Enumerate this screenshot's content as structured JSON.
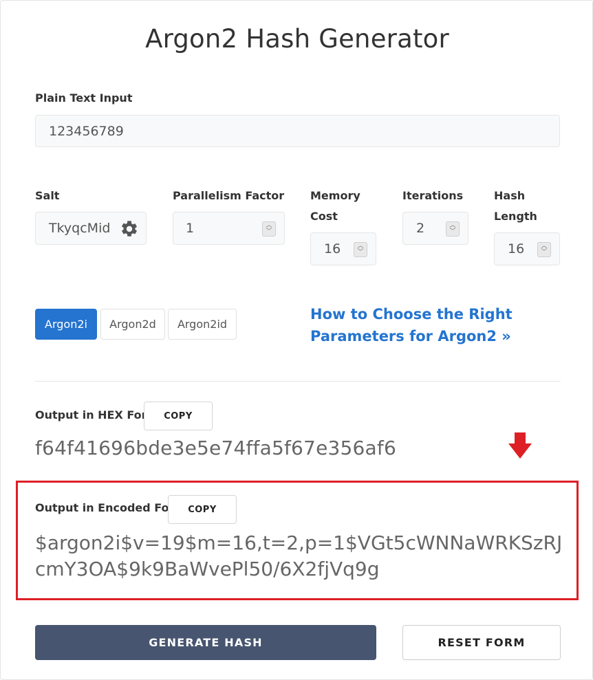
{
  "page": {
    "title": "Argon2 Hash Generator"
  },
  "plain_text": {
    "label": "Plain Text Input",
    "value": "123456789"
  },
  "params": {
    "salt": {
      "label": "Salt",
      "value": "TkyqcMid"
    },
    "parallelism": {
      "label": "Parallelism Factor",
      "value": "1"
    },
    "memory": {
      "label_line1": "Memory",
      "label_line2": "Cost",
      "value": "16"
    },
    "iterations": {
      "label": "Iterations",
      "value": "2"
    },
    "hash_length": {
      "label_line1": "Hash",
      "label_line2": "Length",
      "value": "16"
    }
  },
  "variants": {
    "items": [
      "Argon2i",
      "Argon2d",
      "Argon2id"
    ],
    "selected": "Argon2i"
  },
  "help_link": {
    "line1": "How to Choose the Right",
    "line2": "Parameters for Argon2 »"
  },
  "output_hex": {
    "label": "Output in HEX Form",
    "copy_label": "COPY",
    "value": "f64f41696bde3e5e74ffa5f67e356af6"
  },
  "output_encoded": {
    "label": "Output in Encoded Form",
    "copy_label": "COPY",
    "value": "$argon2i$v=19$m=16,t=2,p=1$VGt5cWNNaWRKSzRJcmY3OA$9k9BaWvePl50/6X2fjVq9g"
  },
  "actions": {
    "generate_label": "GENERATE HASH",
    "reset_label": "RESET FORM"
  },
  "colors": {
    "accent": "#2474d0",
    "primary_button": "#475570",
    "highlight": "#dd1f26"
  },
  "icons": {
    "salt_settings": "gear-icon",
    "arrow": "arrow-down-icon"
  }
}
